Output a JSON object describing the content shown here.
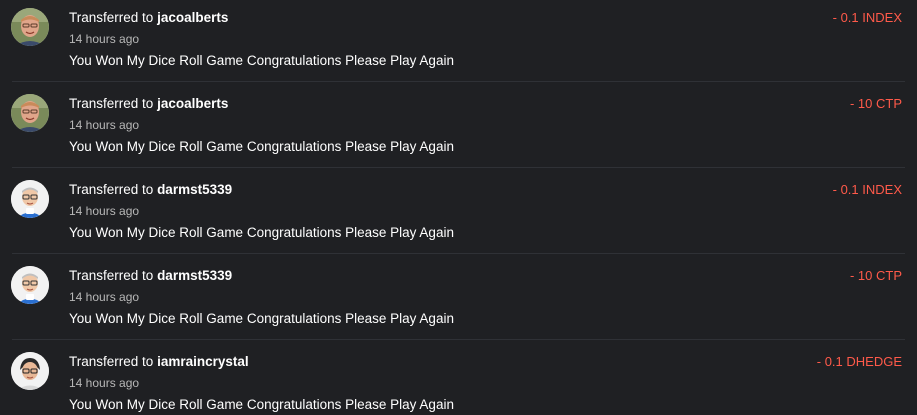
{
  "feed": {
    "items": [
      {
        "prefix": "Transferred to",
        "user": "jacoalberts",
        "time": "14 hours ago",
        "memo": "You Won My Dice Roll Game Congratulations Please Play Again",
        "amount": "- 0.1 INDEX",
        "avatar": "photo-avatar"
      },
      {
        "prefix": "Transferred to",
        "user": "jacoalberts",
        "time": "14 hours ago",
        "memo": "You Won My Dice Roll Game Congratulations Please Play Again",
        "amount": "- 10 CTP",
        "avatar": "photo-avatar"
      },
      {
        "prefix": "Transferred to",
        "user": "darmst5339",
        "time": "14 hours ago",
        "memo": "You Won My Dice Roll Game Congratulations Please Play Again",
        "amount": "- 0.1 INDEX",
        "avatar": "cartoon-avatar"
      },
      {
        "prefix": "Transferred to",
        "user": "darmst5339",
        "time": "14 hours ago",
        "memo": "You Won My Dice Roll Game Congratulations Please Play Again",
        "amount": "- 10 CTP",
        "avatar": "cartoon-avatar"
      },
      {
        "prefix": "Transferred to",
        "user": "iamraincrystal",
        "time": "14 hours ago",
        "memo": "You Won My Dice Roll Game Congratulations Please Play Again",
        "amount": "- 0.1 DHEDGE",
        "avatar": "cartoon-avatar"
      }
    ]
  },
  "colors": {
    "background": "#1f2023",
    "amount": "#ff5a4a",
    "text": "#ffffff",
    "muted": "#b8b8b8",
    "separator": "#2f3136"
  }
}
